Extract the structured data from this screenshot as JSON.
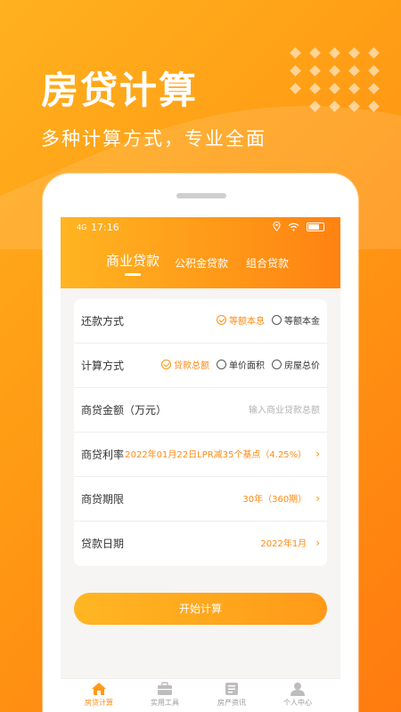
{
  "hero": {
    "title": "房贷计算",
    "subtitle": "多种计算方式，专业全面"
  },
  "status_bar": {
    "signal": "4G",
    "time": "17:16"
  },
  "tabs": [
    {
      "label": "商业贷款",
      "active": true
    },
    {
      "label": "公积金贷款",
      "active": false
    },
    {
      "label": "组合贷款",
      "active": false
    }
  ],
  "form": {
    "repay_method": {
      "label": "还款方式",
      "options": [
        {
          "label": "等额本息",
          "checked": true
        },
        {
          "label": "等额本金",
          "checked": false
        }
      ]
    },
    "calc_method": {
      "label": "计算方式",
      "options": [
        {
          "label": "贷款总额",
          "checked": true
        },
        {
          "label": "单价面积",
          "checked": false
        },
        {
          "label": "房屋总价",
          "checked": false
        }
      ]
    },
    "loan_amount": {
      "label": "商贷金额（万元）",
      "placeholder": "输入商业贷款总额"
    },
    "loan_rate": {
      "label": "商贷利率",
      "value": "2022年01月22日LPR减35个基点（4.25%）"
    },
    "loan_term": {
      "label": "商贷期限",
      "value": "30年（360期）"
    },
    "loan_date": {
      "label": "贷款日期",
      "value": "2022年1月"
    }
  },
  "calc_button": "开始计算",
  "bottom_nav": [
    {
      "label": "房贷计算",
      "icon": "house-icon",
      "active": true
    },
    {
      "label": "实用工具",
      "icon": "toolbox-icon",
      "active": false
    },
    {
      "label": "房产资讯",
      "icon": "news-icon",
      "active": false
    },
    {
      "label": "个人中心",
      "icon": "user-icon",
      "active": false
    }
  ],
  "colors": {
    "accent": "#ff8a12",
    "background_start": "#ffb11e",
    "background_end": "#ff7b0f"
  }
}
